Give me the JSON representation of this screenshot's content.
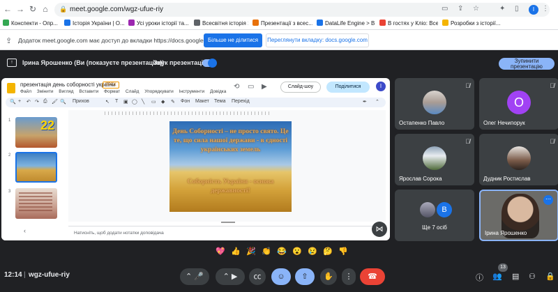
{
  "browser": {
    "url": "meet.google.com/wgz-ufue-riy",
    "bookmarks": [
      {
        "label": "Конспекти - Опр...",
        "color": "#34a853"
      },
      {
        "label": "Історія України | О...",
        "color": "#1a73e8"
      },
      {
        "label": "Усі уроки історії та...",
        "color": "#9c27b0"
      },
      {
        "label": "Всесвітня історія 1...",
        "color": "#5f6368"
      },
      {
        "label": "Презентації з всес...",
        "color": "#e8710a"
      },
      {
        "label": "DataLife Engine > В...",
        "color": "#1a73e8"
      },
      {
        "label": "В гостях у Кліо: Все...",
        "color": "#ea4335"
      },
      {
        "label": "Розробки з історії...",
        "color": "#f4b400"
      }
    ]
  },
  "notice": {
    "text": "Додаток meet.google.com має доступ до вкладки https://docs.google.com",
    "stop_label": "Більше не ділитися",
    "view_label": "Переглянути вкладку: docs.google.com"
  },
  "presenting": {
    "name": "Ірина Ярошенко (Ви (показуєте презентацію))",
    "sound_label": "Звук презентації",
    "stop_label": "Зупинити презентацію"
  },
  "slides": {
    "title": "презентація день соборності україни",
    "badge": "PPTX",
    "menu": [
      "Файл",
      "Змінити",
      "Вигляд",
      "Вставити",
      "Формат",
      "Слайд",
      "Упорядкувати",
      "Інструменти",
      "Довідка"
    ],
    "slideshow_label": "Слайд-шоу",
    "share_label": "Поділитися",
    "avatar_letter": "I",
    "toolbar": {
      "zoom": "Прихов",
      "bg": "Фон",
      "layout": "Макет",
      "theme": "Тема",
      "transition": "Перехід"
    },
    "thumbs": [
      "1",
      "2",
      "3"
    ],
    "thumb1_text": "22",
    "slide_text1": "День Соборності – не просто свято. Це те, що сила нашої держави - в єдності українських земель",
    "slide_text2": "Соборність України - основа державності!",
    "notes_placeholder": "Натисніть, щоб додати нотатки доповідача"
  },
  "participants": [
    {
      "name": "Остапенко Павло"
    },
    {
      "name": "Олег Нечипорук",
      "letter": "О"
    },
    {
      "name": "Ярослав Сорока"
    },
    {
      "name": "Дудник Ростислав"
    },
    {
      "name": "Ще 7 осіб",
      "letter": "В"
    },
    {
      "name": "Ірина Ярошенко"
    }
  ],
  "reactions": [
    "💖",
    "👍",
    "🎉",
    "👏",
    "😂",
    "😮",
    "😢",
    "🤔",
    "👎"
  ],
  "bottom": {
    "time": "12:14",
    "separator": "|",
    "meeting_code": "wgz-ufue-riy",
    "people_count": "13"
  },
  "colors": {
    "accent": "#8ab4f8",
    "leave": "#ea4335",
    "primary": "#1a73e8"
  }
}
